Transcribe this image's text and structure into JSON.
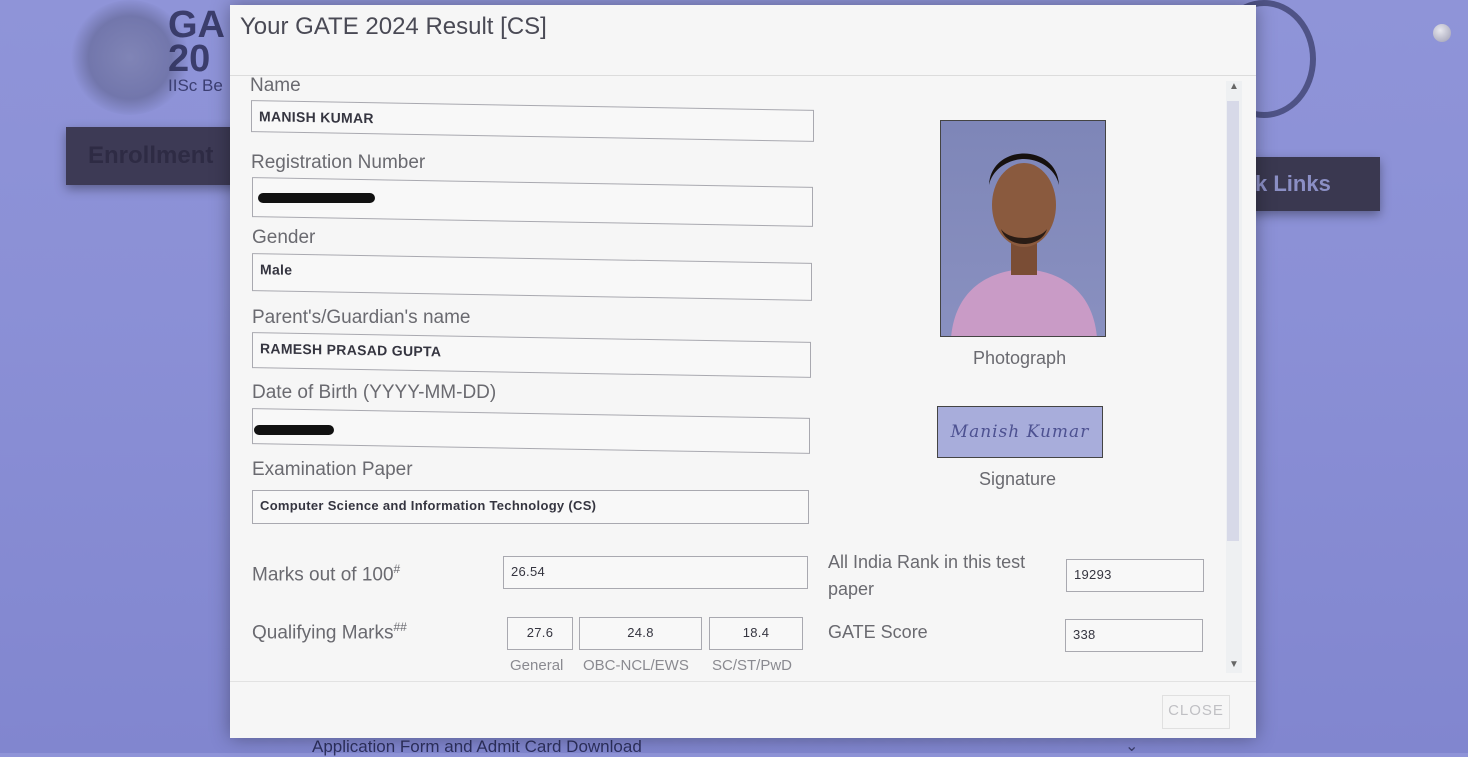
{
  "background": {
    "logo_text": "GA\n20",
    "logo_sub": "IISc Be",
    "left_button": "Enrollment",
    "right_button": "k Links",
    "bottom_link": "Application Form and Admit Card Download"
  },
  "modal": {
    "title": "Your GATE 2024 Result [CS]",
    "fields": {
      "name": {
        "label": "Name",
        "value": "MANISH KUMAR"
      },
      "registration": {
        "label": "Registration Number",
        "value": ""
      },
      "gender": {
        "label": "Gender",
        "value": "Male"
      },
      "guardian": {
        "label": "Parent's/Guardian's name",
        "value": "RAMESH PRASAD GUPTA"
      },
      "dob": {
        "label": "Date of Birth (YYYY-MM-DD)",
        "value": ""
      },
      "paper": {
        "label": "Examination Paper",
        "value": "Computer Science and Information Technology (CS)"
      }
    },
    "photo_caption": "Photograph",
    "signature_caption": "Signature",
    "signature_text": "Manish Kumar",
    "marks": {
      "label": "Marks out of 100",
      "sup": "#",
      "value": "26.54"
    },
    "rank": {
      "label_line1": "All India Rank in this test",
      "label_line2": "paper",
      "value": "19293"
    },
    "qualifying": {
      "label": "Qualifying Marks",
      "sup": "##",
      "general": {
        "value": "27.6",
        "caption": "General"
      },
      "obc": {
        "value": "24.8",
        "caption": "OBC-NCL/EWS"
      },
      "sc": {
        "value": "18.4",
        "caption": "SC/ST/PwD"
      }
    },
    "gate_score": {
      "label": "GATE Score",
      "value": "338"
    },
    "close_label": "CLOSE"
  },
  "icons": {
    "scroll_up": "▲",
    "scroll_down": "▼",
    "chevron": "⌄"
  }
}
